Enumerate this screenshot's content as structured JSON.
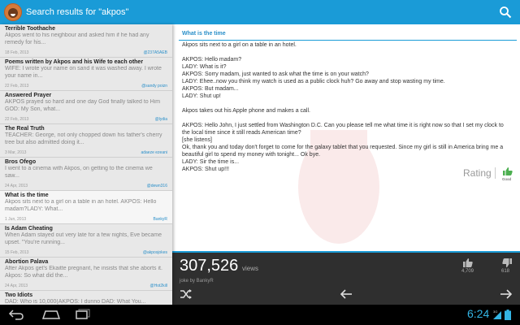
{
  "action_bar": {
    "title": "Search results for \"akpos\"",
    "app_icon": "app-logo-icon",
    "search_icon": "search-icon"
  },
  "results": [
    {
      "title": "Terrible Toothache",
      "snippet": "Akpos went to his neighbour and asked him if he had any remedy for his...",
      "date": "18 Feb, 2013",
      "user": "@237A5AEB"
    },
    {
      "title": "Poems written by Akpos and his Wife to each other",
      "snippet": "WIFE:    I wrote your name on sand       it was washed away. I wrote your name in...",
      "date": "22 Feb, 2013",
      "user": "@sandy poizn"
    },
    {
      "title": "Answered Prayer",
      "snippet": "AKPOS prayed so hard and one day God finally talked to Him GOD: My Son, what...",
      "date": "22 Feb, 2013",
      "user": "@lydia"
    },
    {
      "title": "The Real Truth",
      "snippet": "TEACHER: George, not only chopped down his father's cherry tree but also admitted doing it...",
      "date": "3 Mar, 2013",
      "user": "adaeze ezeani"
    },
    {
      "title": "Bros Ofego",
      "snippet": "I went to a cinema with Akpos, on getting to the cinema we saw...",
      "date": "24 Apr, 2013",
      "user": "@dewn316"
    },
    {
      "title": "What is the time",
      "snippet": "Akpos sits next to a girl on a table in an hotel. AKPOS: Hello madam?LADY: What...",
      "date": "1 Jun, 2013",
      "user": "BankyR"
    },
    {
      "title": "Is Adam Cheating",
      "snippet": "When Adam stayed out very late for a few nights, Eve became upset. \"You're running...",
      "date": "15 Feb, 2013",
      "user": "@akposjokes"
    },
    {
      "title": "Abortion Palava",
      "snippet": "After Akpos get's Ekaitte pregnant, he insists that she aborts it. Akpos: So what did the...",
      "date": "24 Apr, 2013",
      "user": "@Hot2kill"
    },
    {
      "title": "Two Idiots",
      "snippet": "DAD: Who is 10,000(AKPOS: I dunno DAD: What You...",
      "date": "",
      "user": ""
    }
  ],
  "active_index": 5,
  "detail": {
    "title": "What is the time",
    "body": "Akpos sits next to a girl on a table in an hotel.\n\nAKPOS: Hello madam?\nLADY: What is it?\nAKPOS: Sorry madam, just wanted to ask what the time is on your watch?\nLADY: Ehee..now you think my watch is used as a public clock huh? Go away and stop wasting my time.\nAKPOS: But madam...\nLADY: Shut up!\n\nAkpos takes out his Apple phone and makes a call.\n\nAKPOS: Hello John, I just settled from Washington D.C. Can you please tell me what time it is right now so that I set my clock to the local time since it still reads American time?\n[she listens]\nOk, thank you and today don't forget to come for the galaxy tablet that you requested. Since my girl is still in America bring me a beautiful girl to spend my money with tonight... Ok bye.\nLADY: Sir the time is...\nAKPOS: Shut up!!!",
    "rating_label": "Rating",
    "rating_value": "Good"
  },
  "stats": {
    "views": "307,526",
    "views_label": "views",
    "author": "joke by BankyR",
    "likes": "4,709",
    "dislikes": "618"
  },
  "status": {
    "time": "6:24",
    "network": "3G"
  },
  "colors": {
    "accent": "#1a9bd7",
    "positive": "#4caf50",
    "clock": "#33b5e5"
  }
}
